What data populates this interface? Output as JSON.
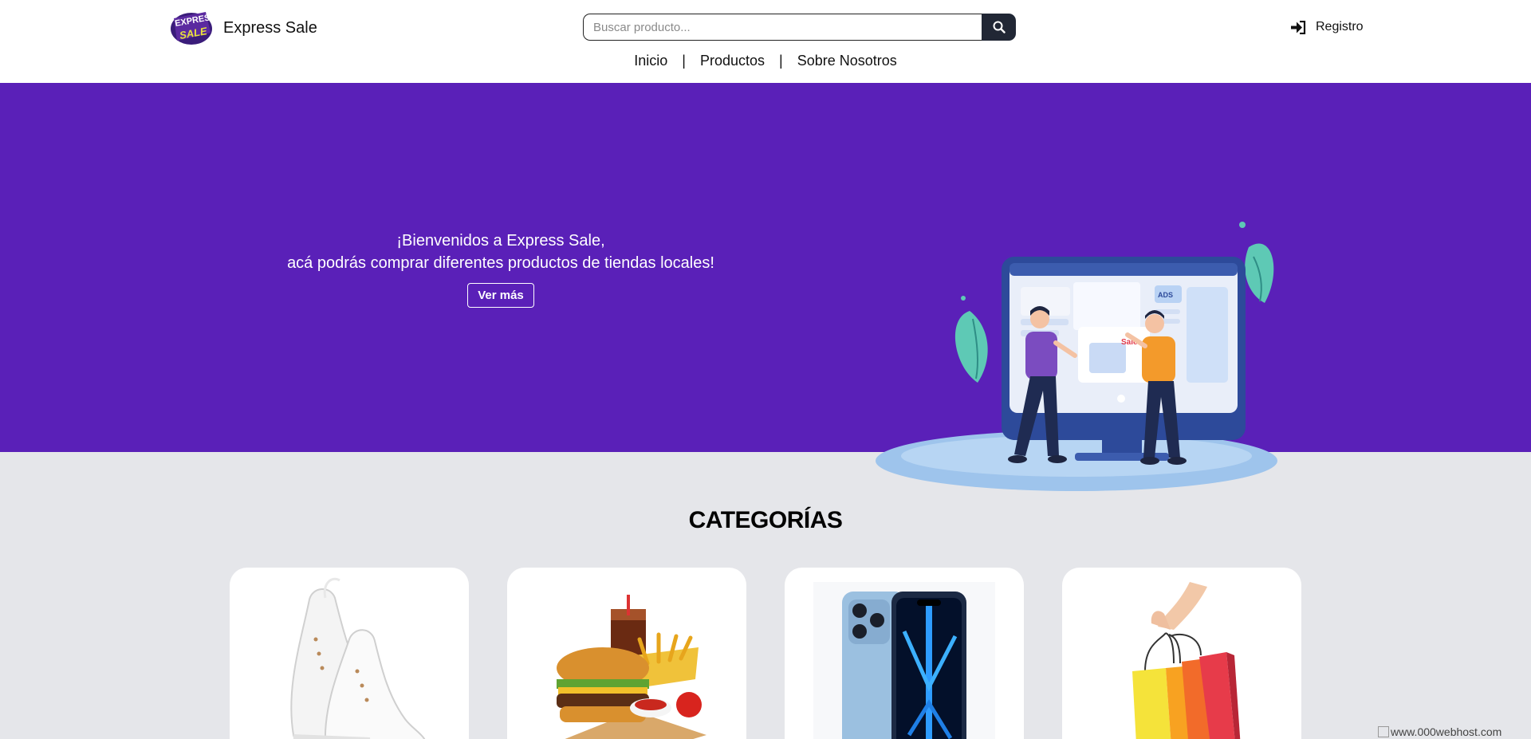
{
  "brand": {
    "name": "Express Sale",
    "logo_text_top": "EXPRESS",
    "logo_text_bottom": "SALE",
    "logo_color": "#3a1c7a"
  },
  "search": {
    "placeholder": "Buscar producto...",
    "icon": "search-icon"
  },
  "header": {
    "register_label": "Registro",
    "register_icon": "sign-in-icon"
  },
  "nav": {
    "items": [
      "Inicio",
      "Productos",
      "Sobre Nosotros"
    ],
    "separator": "|"
  },
  "hero": {
    "line1": "¡Bienvenidos a Express Sale,",
    "line2": "acá podrás comprar diferentes productos de tiendas locales!",
    "button_label": "Ver más",
    "background": "#5a20b8",
    "illustration_badge": "Sale",
    "illustration_ads": "ADS"
  },
  "categories": {
    "title": "CATEGORÍAS",
    "items": [
      {
        "image": "white-sneakers"
      },
      {
        "image": "burger-fries-soda"
      },
      {
        "image": "smartphone"
      },
      {
        "image": "shopping-bags"
      }
    ]
  },
  "footer": {
    "host_badge_alt": "www.000webhost.com"
  }
}
